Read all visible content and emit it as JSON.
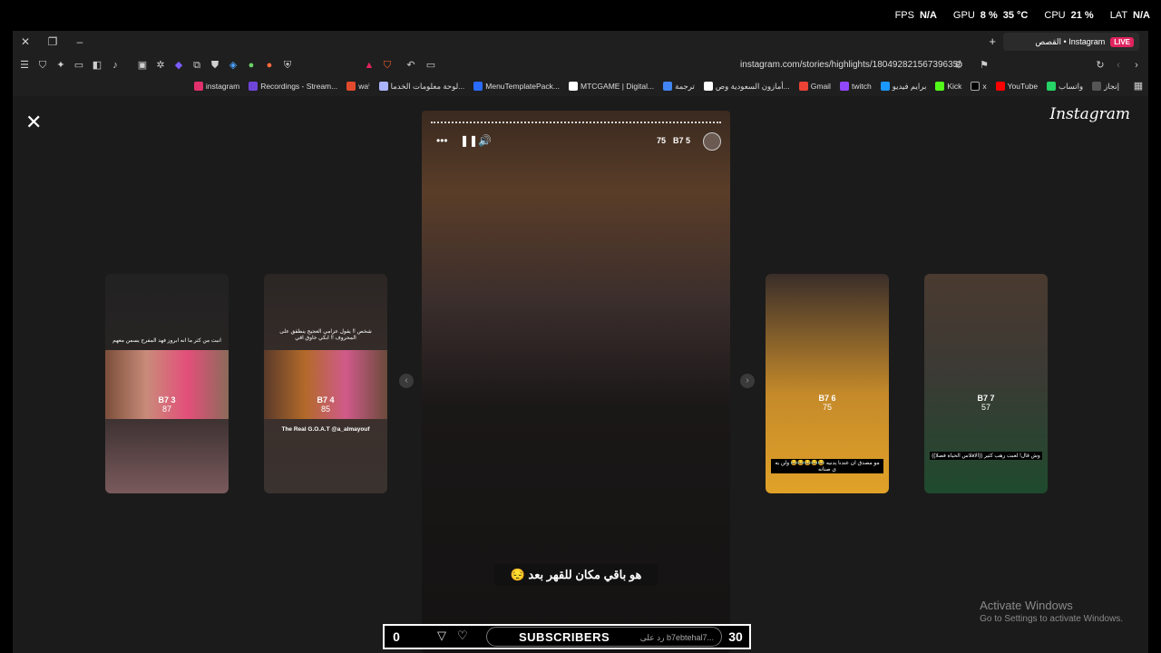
{
  "overlay": {
    "fps_label": "FPS",
    "fps_value": "N/A",
    "gpu_label": "GPU",
    "gpu_value": "8 %",
    "gpu_temp": "35 °C",
    "cpu_label": "CPU",
    "cpu_value": "21 %",
    "lat_label": "LAT",
    "lat_value": "N/A"
  },
  "browser": {
    "tab_title": "القصص • Instagram",
    "live_badge": "LIVE",
    "url": "instagram.com/stories/highlights/18049282156739635/",
    "bookmarks": [
      "إنجاز",
      "واتساب",
      "YouTube",
      "x",
      "Kick",
      "برايم فيديو",
      "twitch",
      "Gmail",
      "أمازون السعودية وص...",
      "ترجمة",
      "MTCGAME | Digital...",
      "MenuTemplatePack...",
      "لوحة معلومات الخدما...",
      "waⁱ",
      "Recordings - Stream...",
      "instagram"
    ]
  },
  "viewer": {
    "logo": "Instagram",
    "side_stories": [
      {
        "caption": "انبت من كثر ما انه ابروز فهد المفرج يسمن معهم",
        "badge": "B7 3",
        "count": "87"
      },
      {
        "caption": "شخص !! يقول عزامي العجيج ينطقق على المحروف !! ابكي خاوق اقي",
        "badge": "B7 4",
        "count": "85",
        "footer": "The Real G.O.A.T @a_almayouf"
      },
      {
        "caption": "مو مصدق ان عندنا يدنيه 😂😂😂😂😂 ولن يه ي صنانه",
        "badge": "B7 6",
        "count": "75"
      },
      {
        "caption": "وش قال! لعبت رهب كثير ((الافلاس الحياة فصلا))",
        "badge": "B7 7",
        "count": "57"
      }
    ],
    "current_story": {
      "badge": "B7 5",
      "count": "75",
      "subtitle": "هو باقي مكان للقهر بعد 😔"
    }
  },
  "windows_watermark": {
    "title": "Activate Windows",
    "subtitle": "Go to Settings to activate Windows."
  },
  "stream_bar": {
    "left_count": "0",
    "title": "SUBSCRIBERS",
    "reply_placeholder": "رد على b7ebtehal7...",
    "right_count": "30"
  }
}
